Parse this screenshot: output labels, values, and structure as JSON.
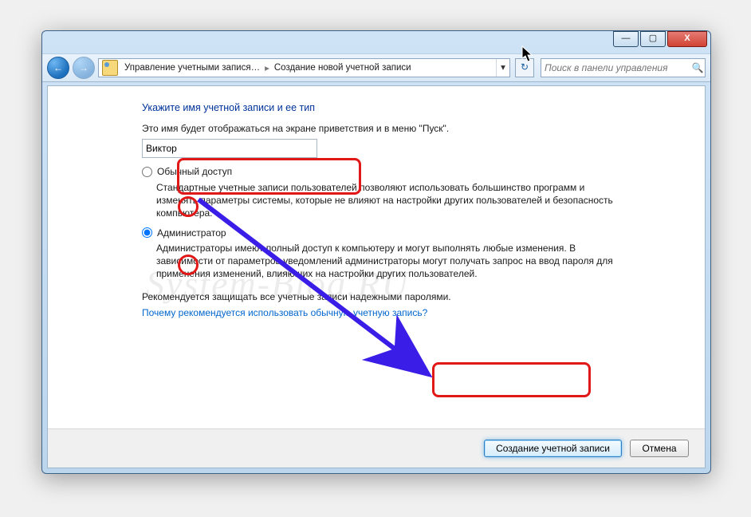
{
  "breadcrumb": {
    "seg1": "Управление учетными запися…",
    "seg2": "Создание новой учетной записи"
  },
  "search": {
    "placeholder": "Поиск в панели управления"
  },
  "heading": "Укажите имя учетной записи и ее тип",
  "desc": "Это имя будет отображаться на экране приветствия и в меню \"Пуск\".",
  "name_value": "Виктор",
  "standard": {
    "label": "Обычный доступ",
    "desc": "Стандартные учетные записи пользователей позволяют использовать большинство программ и изменять параметры системы, которые не влияют на настройки других пользователей и безопасность компьютера."
  },
  "admin": {
    "label": "Администратор",
    "desc": "Администраторы имеют полный доступ к компьютеру и могут выполнять любые изменения. В зависимости от параметров уведомлений администраторы могут получать запрос на ввод пароля для применения изменений, влияющих на настройки других пользователей."
  },
  "recommend": "Рекомендуется защищать все учетные записи надежными паролями.",
  "whylink": "Почему рекомендуется использовать обычную учетную запись?",
  "buttons": {
    "create": "Создание учетной записи",
    "cancel": "Отмена"
  },
  "watermark": "System-Blog.RU",
  "titlebtn": {
    "min": "—",
    "max": "▢",
    "close": "X"
  }
}
